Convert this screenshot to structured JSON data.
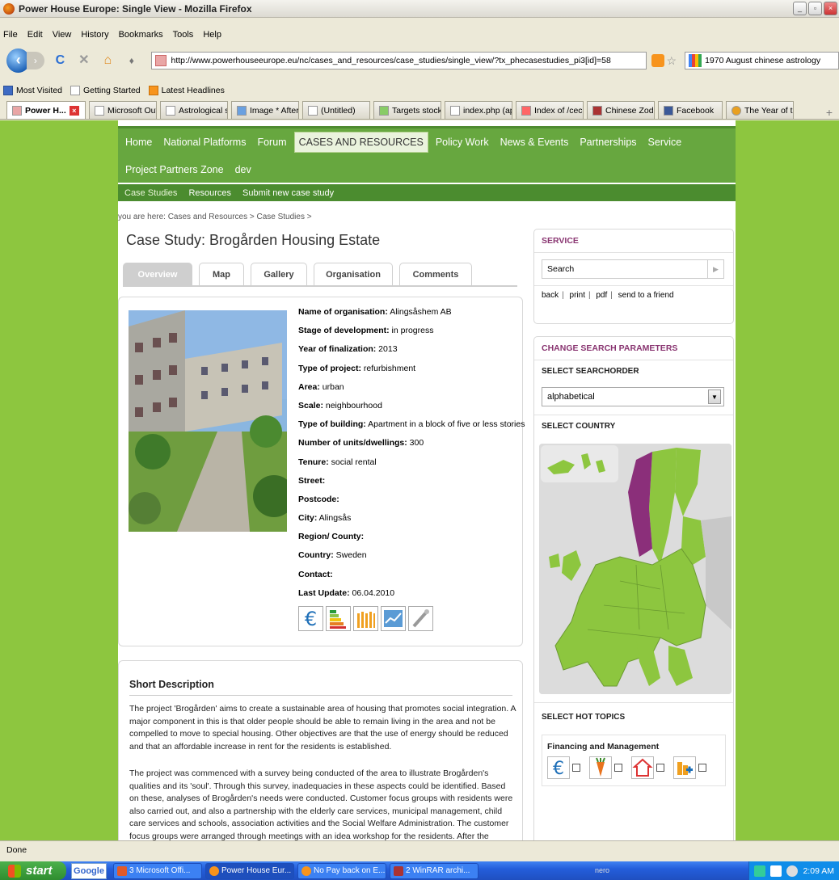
{
  "window": {
    "title": "Power House Europe: Single View - Mozilla Firefox"
  },
  "menu": [
    "File",
    "Edit",
    "View",
    "History",
    "Bookmarks",
    "Tools",
    "Help"
  ],
  "toolbar": {
    "url": "http://www.powerhouseeurope.eu/nc/cases_and_resources/case_studies/single_view/?tx_phecasestudies_pi3[id]=58",
    "search_value": "1970 August chinese astrology"
  },
  "bookmarks": [
    "Most Visited",
    "Getting Started",
    "Latest Headlines"
  ],
  "browser_tabs": [
    {
      "label": "Power H...",
      "active": true
    },
    {
      "label": "Microsoft Outl...",
      "active": false
    },
    {
      "label": "Astrological si...",
      "active": false
    },
    {
      "label": "Image * After ...",
      "active": false
    },
    {
      "label": "(Untitled)",
      "active": false
    },
    {
      "label": "Targets stock ...",
      "active": false
    },
    {
      "label": "index.php (ap...",
      "active": false
    },
    {
      "label": "Index of /ceco...",
      "active": false
    },
    {
      "label": "Chinese Zodia...",
      "active": false
    },
    {
      "label": "Facebook",
      "active": false
    },
    {
      "label": "The Year of th...",
      "active": false
    }
  ],
  "site": {
    "main_nav_row1": [
      "Home",
      "National Platforms",
      "Forum",
      "CASES AND RESOURCES",
      "Policy Work",
      "News & Events",
      "Partnerships",
      "Service"
    ],
    "main_nav_row2": [
      "Project Partners Zone",
      "dev"
    ],
    "sub_nav": [
      "Case Studies",
      "Resources",
      "Submit new case study"
    ],
    "breadcrumb": "you are here:  Cases and Resources > Case Studies >",
    "title": "Case Study: Brogården Housing Estate",
    "content_tabs": [
      "Overview",
      "Map",
      "Gallery",
      "Organisation",
      "Comments"
    ],
    "properties": [
      {
        "k": "Name of organisation:",
        "v": " Alingsåshem AB"
      },
      {
        "k": "Stage of development:",
        "v": " in progress"
      },
      {
        "k": "Year of finalization:",
        "v": " 2013"
      },
      {
        "k": "Type of project:",
        "v": " refurbishment"
      },
      {
        "k": "Area:",
        "v": " urban"
      },
      {
        "k": "Scale:",
        "v": " neighbourhood"
      },
      {
        "k": "Type of building:",
        "v": " Apartment in a block of five or less stories"
      },
      {
        "k": "Number of units/dwellings:",
        "v": " 300"
      },
      {
        "k": "Tenure:",
        "v": " social rental"
      },
      {
        "k": "Street:",
        "v": ""
      },
      {
        "k": "Postcode:",
        "v": ""
      },
      {
        "k": "City:",
        "v": " Alingsås"
      },
      {
        "k": "Region/ County:",
        "v": ""
      },
      {
        "k": "Country:",
        "v": " Sweden"
      },
      {
        "k": "Contact:",
        "v": ""
      },
      {
        "k": "Last Update:",
        "v": " 06.04.2010"
      }
    ],
    "short_description_title": "Short Description",
    "desc_p1": "The project 'Brogården' aims to create a sustainable area of housing that promotes social integration. A major component in this is that older people should be able to remain living in the area and not be compelled to move to special housing. Other objectives are that the use of energy should be reduced and that an affordable increase in rent for the residents is established.",
    "desc_p2": "The project was commenced with a survey being conducted of the area to illustrate Brogården's qualities and its 'soul'. Through this survey, inadequacies in these aspects could be identified. Based on these, analyses of Brogården's needs were conducted. Customer focus groups with residents were also carried out, and also a partnership with the elderly care services, municipal management, child care services and schools, association activities and the Social Welfare Administration. The customer focus groups were arranged through meetings with an idea workshop for the residents. After the renovation, Brogården will be"
  },
  "sidebar": {
    "service_title": "SERVICE",
    "search_value": "Search",
    "links": [
      "back",
      "print",
      "pdf",
      "send to a friend"
    ],
    "change_title": "CHANGE SEARCH PARAMETERS",
    "searchorder_label": "SELECT SEARCHORDER",
    "searchorder_value": "alphabetical",
    "country_label": "SELECT COUNTRY",
    "hot_topics_label": "SELECT HOT TOPICS",
    "topic_title": "Financing and Management"
  },
  "status": "Done",
  "taskbar": {
    "start": "start",
    "google": "Google",
    "items": [
      "3 Microsoft Offi...",
      "Power House Eur...",
      "No Pay back on E...",
      "2 WinRAR archi..."
    ],
    "nero": "nero",
    "time": "2:09 AM"
  },
  "colors": {
    "site_green": "#8dc63f",
    "nav_green": "#67a73f",
    "accent_purple": "#893571"
  }
}
